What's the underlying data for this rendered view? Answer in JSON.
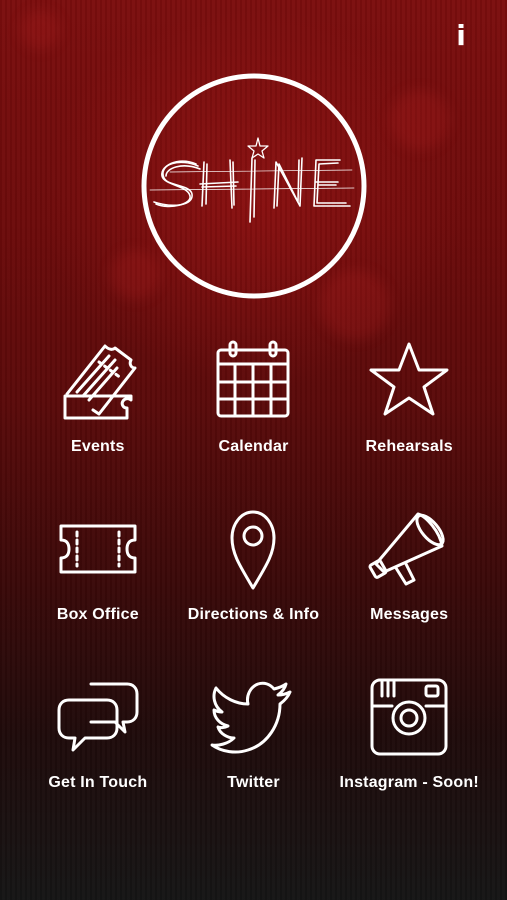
{
  "header": {
    "info_label": "i"
  },
  "logo": {
    "text": "SHINE"
  },
  "menu": [
    {
      "label": "Events",
      "icon": "ticket-icon"
    },
    {
      "label": "Calendar",
      "icon": "calendar-icon"
    },
    {
      "label": "Rehearsals",
      "icon": "star-icon"
    },
    {
      "label": "Box Office",
      "icon": "box-office-ticket-icon"
    },
    {
      "label": "Directions & Info",
      "icon": "map-pin-icon"
    },
    {
      "label": "Messages",
      "icon": "megaphone-icon"
    },
    {
      "label": "Get In Touch",
      "icon": "chat-bubbles-icon"
    },
    {
      "label": "Twitter",
      "icon": "twitter-bird-icon"
    },
    {
      "label": "Instagram - Soon!",
      "icon": "instagram-camera-icon"
    }
  ],
  "colors": {
    "accent": "#ffffff",
    "background_top": "#7c0e0e",
    "background_bottom": "#151515"
  }
}
